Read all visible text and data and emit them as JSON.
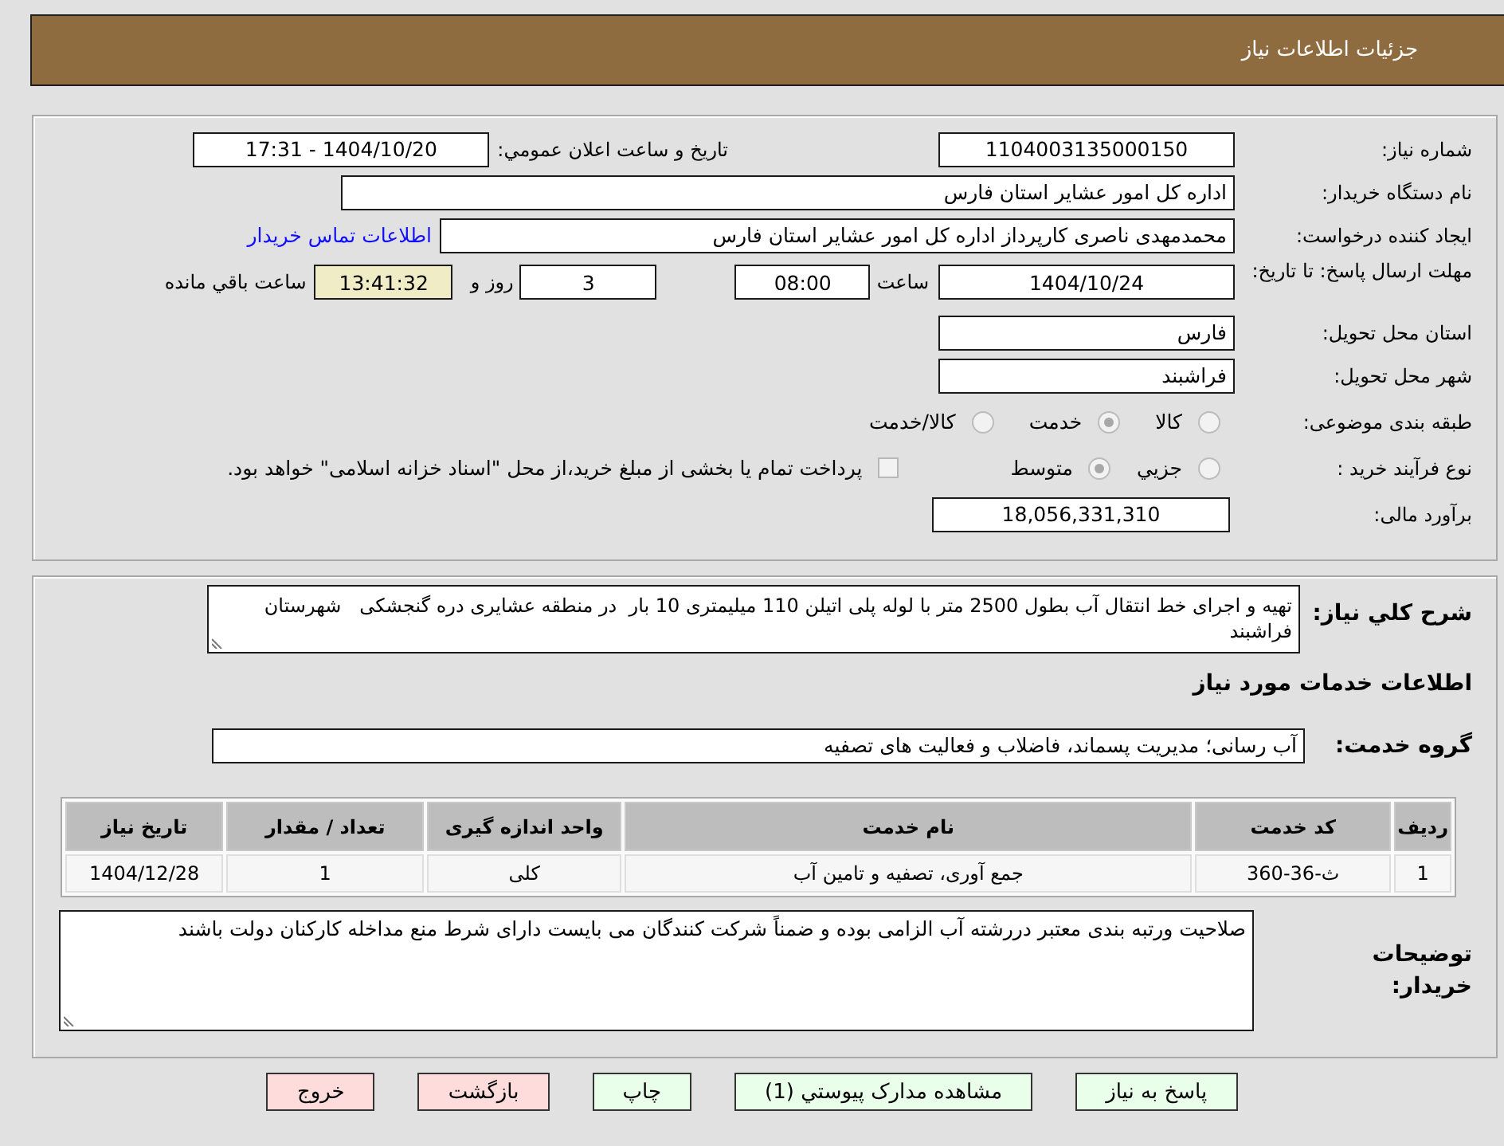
{
  "header": {
    "title": "جزئیات اطلاعات نیاز"
  },
  "details": {
    "need_number": {
      "label": "شماره نیاز:",
      "value": "1104003135000150"
    },
    "announcement": {
      "label": "تاریخ و ساعت اعلان عمومي:",
      "value": "1404/10/20 - 17:31"
    },
    "buyer_org": {
      "label": "نام دستگاه خریدار:",
      "value": "اداره کل امور عشایر استان فارس"
    },
    "requester": {
      "label": "ایجاد کننده درخواست:",
      "value": "محمدمهدی ناصری کارپرداز اداره کل امور عشایر استان فارس",
      "contact_link": "اطلاعات تماس خریدار"
    },
    "deadline": {
      "label": "مهلت ارسال پاسخ: تا تاریخ:",
      "date": "1404/10/24",
      "time_label": "ساعت",
      "time": "08:00",
      "days": "3",
      "days_label": "روز و",
      "remaining": "13:41:32",
      "remaining_label": "ساعت باقي مانده"
    },
    "province": {
      "label": "استان محل تحویل:",
      "value": "فارس"
    },
    "city": {
      "label": "شهر محل تحویل:",
      "value": "فراشبند"
    },
    "category": {
      "label": "طبقه بندی موضوعی:",
      "options": [
        {
          "label": "کالا",
          "selected": false,
          "disabled": true
        },
        {
          "label": "خدمت",
          "selected": true,
          "disabled": true
        },
        {
          "label": "کالا/خدمت",
          "selected": false,
          "disabled": true
        }
      ]
    },
    "purchase_type": {
      "label": "نوع فرآیند خرید :",
      "options": [
        {
          "label": "جزيي",
          "selected": false,
          "disabled": true
        },
        {
          "label": "متوسط",
          "selected": true,
          "disabled": true
        }
      ],
      "treasury_payment": {
        "label": "پرداخت تمام یا بخشی از مبلغ خرید،از محل \"اسناد خزانه اسلامی\" خواهد بود.",
        "checked": false,
        "disabled": true
      }
    },
    "budget": {
      "label": "برآورد مالی:",
      "value": "18,056,331,310"
    }
  },
  "needs": {
    "description": {
      "label": "شرح کلي نیاز:",
      "value": "تهیه و اجرای خط انتقال آب بطول 2500 متر با لوله پلی اتیلن 110 میلیمتری 10 بار  در منطقه عشایری دره گنجشکی   شهرستان فراشبند"
    },
    "section_title": "اطلاعات خدمات مورد نیاز",
    "service_group": {
      "label": "گروه خدمت:",
      "value": "آب رسانی؛ مدیریت پسماند، فاضلاب و فعالیت های تصفیه"
    },
    "table": {
      "columns": [
        "ردیف",
        "کد خدمت",
        "نام خدمت",
        "واحد اندازه گیری",
        "تعداد / مقدار",
        "تاریخ نیاز"
      ],
      "rows": [
        [
          "1",
          "ث-36-360",
          "جمع آوری، تصفیه و تامین آب",
          "کلی",
          "1",
          "1404/12/28"
        ]
      ]
    },
    "buyer_notes": {
      "label": "توضیحات خریدار:",
      "value": "صلاحیت ورتبه بندی معتبر دررشته آب الزامی بوده و ضمناً شرکت کنندگان می بایست دارای شرط منع مداخله کارکنان دولت باشند"
    }
  },
  "buttons": [
    {
      "label": "پاسخ به نیاز",
      "kind": "normal"
    },
    {
      "label": "مشاهده مدارک پیوستي (1)",
      "kind": "normal"
    },
    {
      "label": "چاپ",
      "kind": "normal"
    },
    {
      "label": "بازگشت",
      "kind": "danger"
    },
    {
      "label": "خروج",
      "kind": "danger"
    }
  ]
}
